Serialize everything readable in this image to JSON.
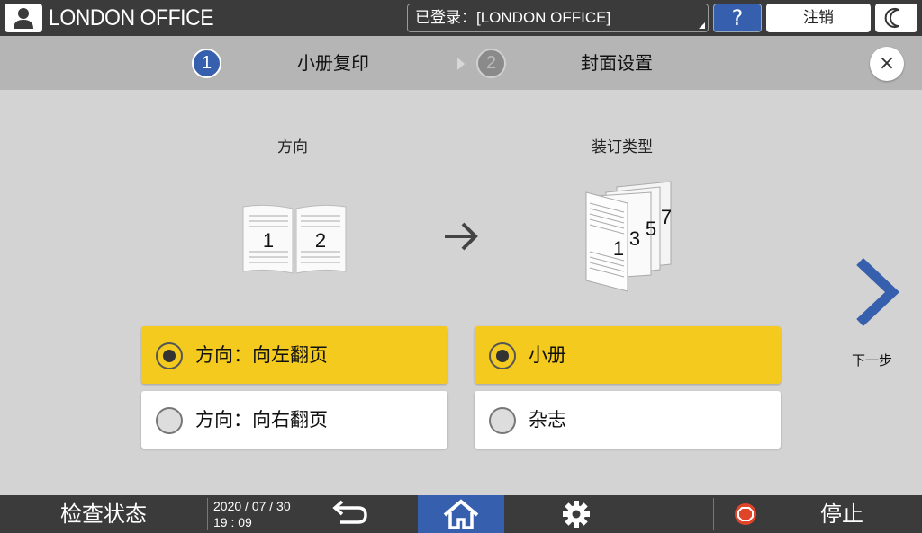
{
  "header": {
    "office_name": "LONDON OFFICE",
    "login_text": "已登录：[LONDON OFFICE]",
    "help_label": "?",
    "logout_label": "注销"
  },
  "steps": [
    {
      "number": "1",
      "label": "小册复印"
    },
    {
      "number": "2",
      "label": "封面设置"
    }
  ],
  "close_label": "×",
  "orientation": {
    "title": "方向",
    "illustration_pages": [
      "1",
      "2"
    ],
    "options": [
      {
        "label": "方向：向左翻页",
        "selected": true
      },
      {
        "label": "方向：向右翻页",
        "selected": false
      }
    ]
  },
  "binding": {
    "title": "装订类型",
    "illustration_pages": [
      "1",
      "3",
      "5",
      "7"
    ],
    "options": [
      {
        "label": "小册",
        "selected": true
      },
      {
        "label": "杂志",
        "selected": false
      }
    ]
  },
  "next_label": "下一步",
  "footer": {
    "check_status": "检查状态",
    "date": "2020 / 07 / 30",
    "time": "19 : 09",
    "stop_label": "停止"
  },
  "colors": {
    "accent_blue": "#3660ad",
    "selected_yellow": "#f4ca1f",
    "bar_dark": "#3b3b3b",
    "stop_red": "#e0452a"
  }
}
